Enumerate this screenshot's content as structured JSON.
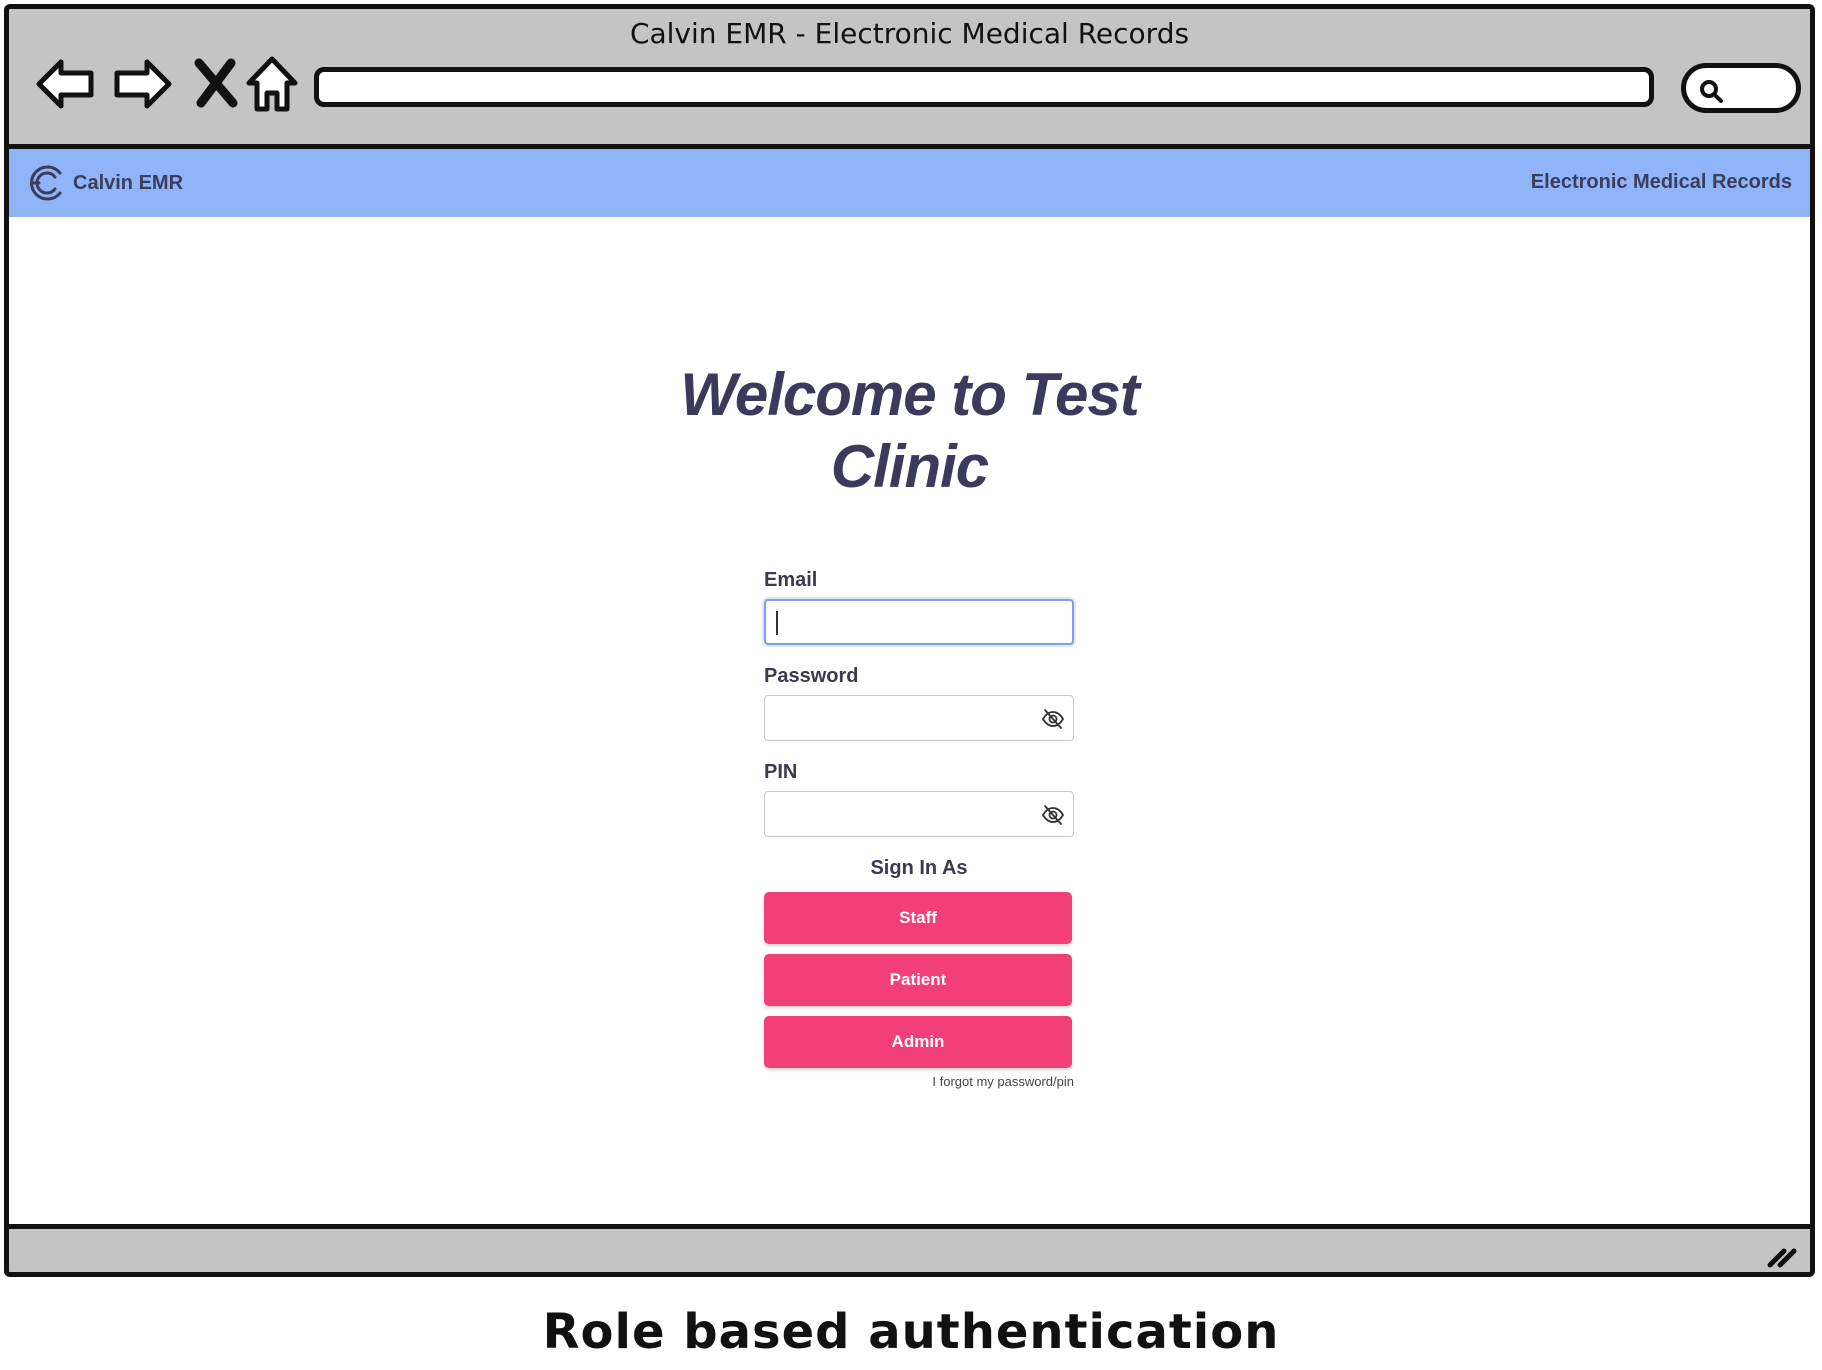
{
  "window": {
    "title": "Calvin EMR - Electronic Medical Records",
    "address_value": "",
    "search_value": ""
  },
  "nav_icons": [
    "back-arrow-icon",
    "forward-arrow-icon",
    "stop-icon",
    "home-icon",
    "search-icon"
  ],
  "appbar": {
    "brand_name": "Calvin EMR",
    "right_text": "Electronic Medical Records",
    "color": "#8fb4f8"
  },
  "main": {
    "welcome_title": "Welcome to Test Clinic",
    "email": {
      "label": "Email",
      "value": ""
    },
    "password": {
      "label": "Password",
      "value": ""
    },
    "pin": {
      "label": "PIN",
      "value": ""
    },
    "sign_in_as": "Sign In As",
    "buttons": {
      "staff": "Staff",
      "patient": "Patient",
      "admin": "Admin"
    },
    "button_color": "#f23f77",
    "forgot_link": "I forgot my password/pin"
  },
  "caption": "Role based authentication"
}
